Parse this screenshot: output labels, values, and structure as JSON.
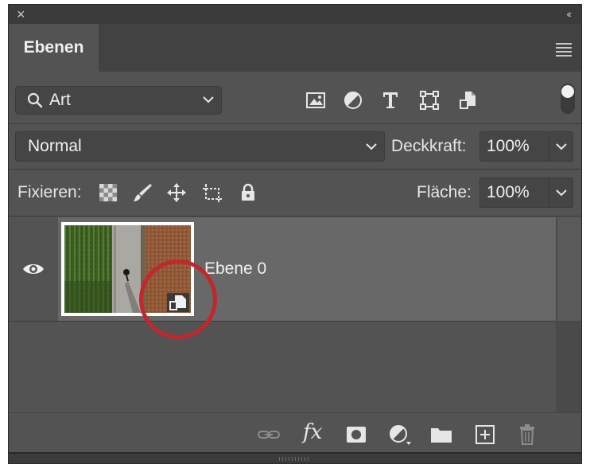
{
  "window": {
    "close_glyph": "×",
    "collapse_glyph": "‹‹"
  },
  "tabs": [
    {
      "label": "Ebenen",
      "active": true
    }
  ],
  "filter": {
    "label": "Art",
    "icons": [
      "image-filter-icon",
      "adjustment-filter-icon",
      "type-filter-icon",
      "shape-filter-icon",
      "smart-object-filter-icon"
    ],
    "toggle_on": true
  },
  "blend": {
    "mode": "Normal",
    "opacity_label": "Deckkraft:",
    "opacity_value": "100%"
  },
  "lock": {
    "label": "Fixieren:",
    "icons": [
      "lock-transparent-pixels-icon",
      "lock-image-pixels-icon",
      "lock-position-icon",
      "lock-artboard-icon",
      "lock-all-icon"
    ],
    "fill_label": "Fläche:",
    "fill_value": "100%"
  },
  "layers": [
    {
      "name": "Ebene 0",
      "visible": true,
      "smart_object": true,
      "selected": true
    }
  ],
  "footer": {
    "icons": [
      "link-layers-icon",
      "fx-icon",
      "add-mask-icon",
      "adjustment-layer-icon",
      "new-group-icon",
      "new-layer-icon",
      "delete-layer-icon"
    ],
    "fx_text": "fx"
  },
  "colors": {
    "panel_bg": "#535353",
    "selected_row": "#686868",
    "highlight_circle": "#c1272d"
  }
}
